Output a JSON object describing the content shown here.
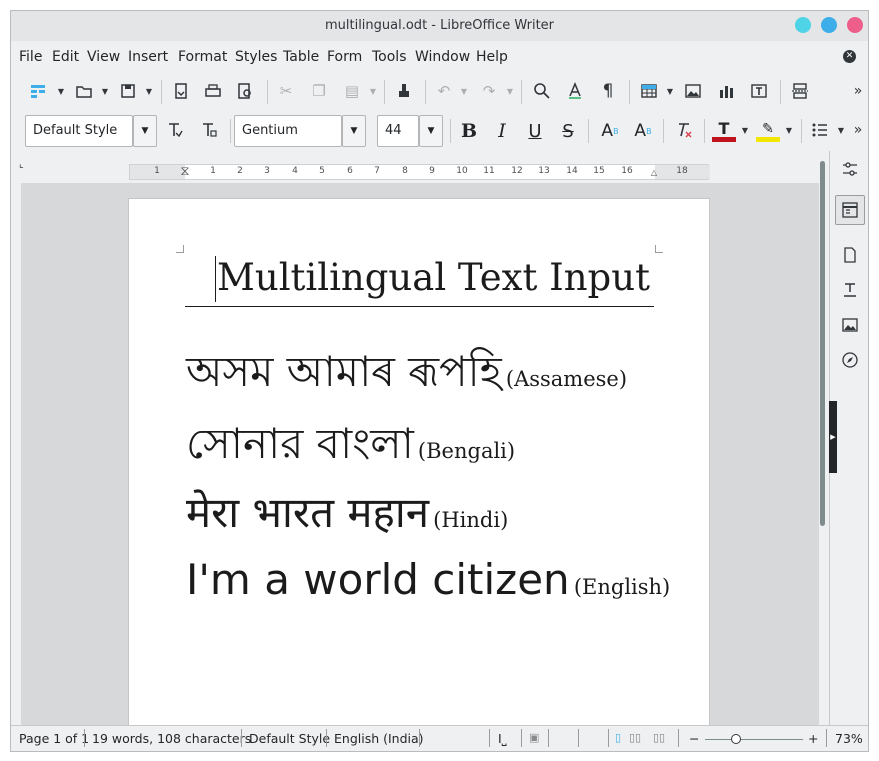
{
  "window": {
    "title": "multilingual.odt - LibreOffice Writer",
    "buttons": {
      "minimize_color": "#4fd3e6",
      "maximize_color": "#3daee9",
      "close_color": "#ed5e8a"
    }
  },
  "menubar": {
    "items": [
      "File",
      "Edit",
      "View",
      "Insert",
      "Format",
      "Styles",
      "Table",
      "Form",
      "Tools",
      "Window",
      "Help"
    ]
  },
  "toolbar": {
    "paragraph_style": "Default Style",
    "font_name": "Gentium",
    "font_size": "44",
    "bold_label": "B",
    "italic_label": "I",
    "underline_label": "U",
    "strike_label": "S",
    "superscript_label": "A",
    "subscript_label": "A",
    "font_color": "#c0141c",
    "highlight_color": "#f3e600",
    "overflow_label": "»"
  },
  "ruler": {
    "numbers": [
      "1",
      "1",
      "2",
      "3",
      "4",
      "5",
      "6",
      "7",
      "8",
      "9",
      "10",
      "11",
      "12",
      "13",
      "14",
      "15",
      "16",
      "17",
      "18"
    ]
  },
  "document": {
    "title": "Multilingual Text Input",
    "lines": [
      {
        "text": "অসম আমাৰ ৰূপহি",
        "lang": "(Assamese)"
      },
      {
        "text": "সোনার বাংলা",
        "lang": "(Bengali)"
      },
      {
        "text": "मेरा भारत महान",
        "lang": "(Hindi)"
      },
      {
        "text": "I'm a world citizen",
        "lang": "(English)"
      }
    ]
  },
  "statusbar": {
    "page": "Page 1 of 1",
    "words": "19 words, 108 characters",
    "style": "Default Style",
    "language": "English (India)",
    "zoom_minus": "−",
    "zoom_plus": "+",
    "zoom": "73%"
  }
}
